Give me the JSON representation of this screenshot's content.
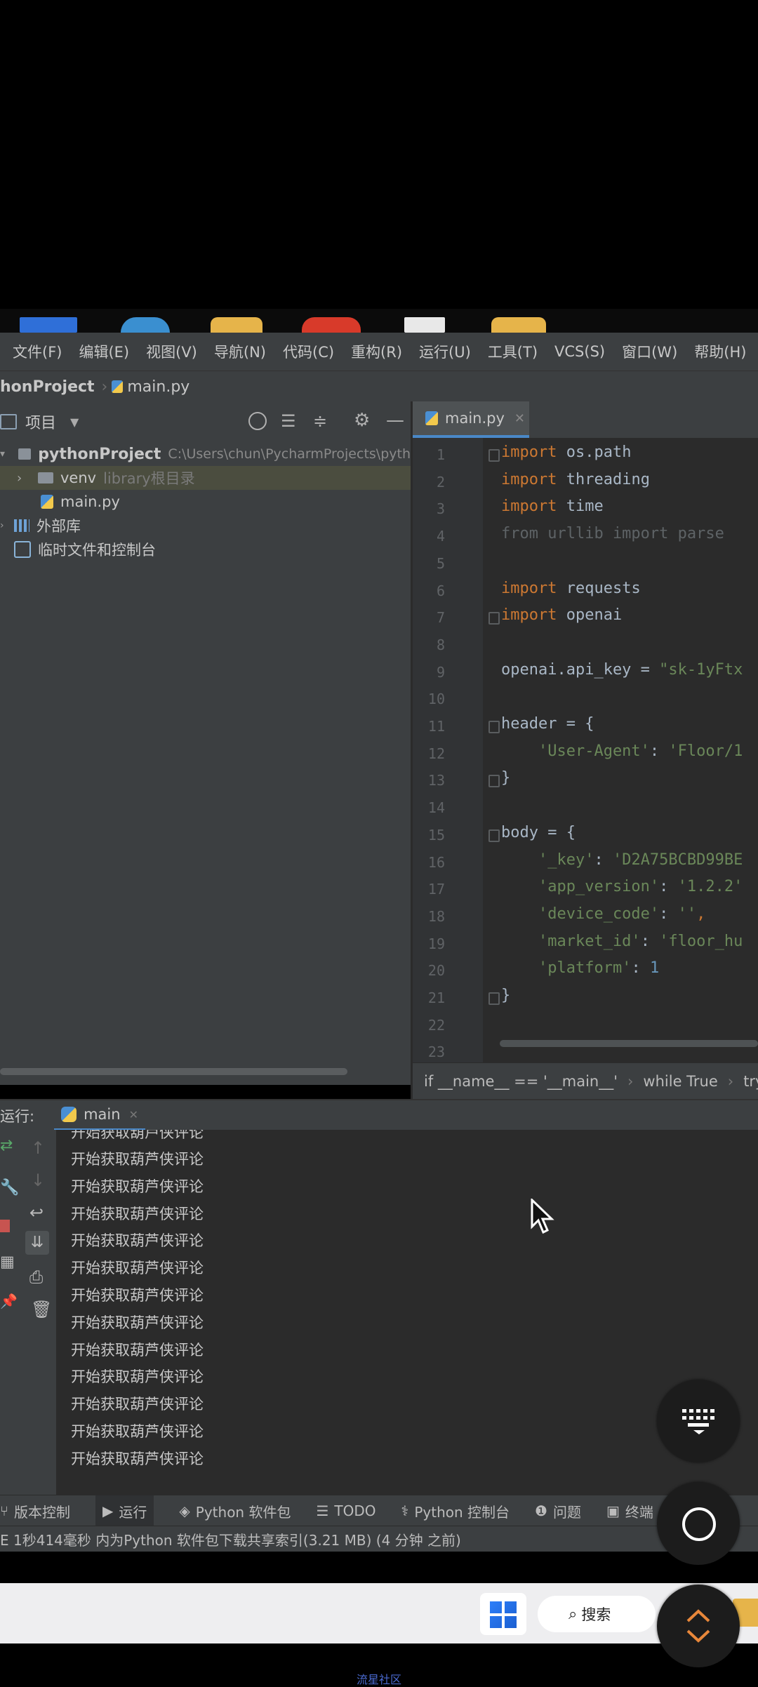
{
  "menu": [
    "文件(F)",
    "编辑(E)",
    "视图(V)",
    "导航(N)",
    "代码(C)",
    "重构(R)",
    "运行(U)",
    "工具(T)",
    "VCS(S)",
    "窗口(W)",
    "帮助(H)"
  ],
  "breadcrumb": {
    "project": "honProject",
    "file": "main.py"
  },
  "project_panel": {
    "title": "项目"
  },
  "tree": {
    "root_name": "pythonProject",
    "root_path": "C:\\Users\\chun\\PycharmProjects\\pyth",
    "venv_name": "venv",
    "venv_note": "library根目录",
    "main_file": "main.py",
    "external_libs": "外部库",
    "scratches": "临时文件和控制台"
  },
  "editor": {
    "tab": "main.py",
    "lines": [
      {
        "n": "1",
        "tokens": [
          {
            "t": "import",
            "c": "kw"
          },
          {
            "t": " os.path",
            "c": ""
          }
        ]
      },
      {
        "n": "2",
        "tokens": [
          {
            "t": "import",
            "c": "kw"
          },
          {
            "t": " threading",
            "c": ""
          }
        ]
      },
      {
        "n": "3",
        "tokens": [
          {
            "t": "import",
            "c": "kw"
          },
          {
            "t": " time",
            "c": ""
          }
        ]
      },
      {
        "n": "4",
        "tokens": [
          {
            "t": "from urllib import parse",
            "c": "dim"
          }
        ]
      },
      {
        "n": "5",
        "tokens": []
      },
      {
        "n": "6",
        "tokens": [
          {
            "t": "import",
            "c": "kw"
          },
          {
            "t": " requests",
            "c": ""
          }
        ]
      },
      {
        "n": "7",
        "tokens": [
          {
            "t": "import",
            "c": "kw"
          },
          {
            "t": " openai",
            "c": ""
          }
        ]
      },
      {
        "n": "8",
        "tokens": []
      },
      {
        "n": "9",
        "tokens": [
          {
            "t": "openai.api_key = ",
            "c": ""
          },
          {
            "t": "\"sk-1yFtx",
            "c": "str"
          }
        ]
      },
      {
        "n": "10",
        "tokens": []
      },
      {
        "n": "11",
        "tokens": [
          {
            "t": "header = {",
            "c": ""
          }
        ]
      },
      {
        "n": "12",
        "tokens": [
          {
            "t": "    'User-Agent'",
            "c": "str"
          },
          {
            "t": ": ",
            "c": ""
          },
          {
            "t": "'Floor/1",
            "c": "str"
          }
        ]
      },
      {
        "n": "13",
        "tokens": [
          {
            "t": "}",
            "c": ""
          }
        ]
      },
      {
        "n": "14",
        "tokens": []
      },
      {
        "n": "15",
        "tokens": [
          {
            "t": "body = {",
            "c": ""
          }
        ]
      },
      {
        "n": "16",
        "tokens": [
          {
            "t": "    '_key'",
            "c": "str"
          },
          {
            "t": ": ",
            "c": ""
          },
          {
            "t": "'D2A75BCBD99BE",
            "c": "str"
          }
        ]
      },
      {
        "n": "17",
        "tokens": [
          {
            "t": "    'app_version'",
            "c": "str"
          },
          {
            "t": ": ",
            "c": ""
          },
          {
            "t": "'1.2.2'",
            "c": "str"
          }
        ]
      },
      {
        "n": "18",
        "tokens": [
          {
            "t": "    'device_code'",
            "c": "str"
          },
          {
            "t": ": ",
            "c": ""
          },
          {
            "t": "''",
            "c": "str"
          },
          {
            "t": ",",
            "c": "kw"
          }
        ]
      },
      {
        "n": "19",
        "tokens": [
          {
            "t": "    'market_id'",
            "c": "str"
          },
          {
            "t": ": ",
            "c": ""
          },
          {
            "t": "'floor_hu",
            "c": "str"
          }
        ]
      },
      {
        "n": "20",
        "tokens": [
          {
            "t": "    'platform'",
            "c": "str"
          },
          {
            "t": ": ",
            "c": ""
          },
          {
            "t": "1",
            "c": "num"
          }
        ]
      },
      {
        "n": "21",
        "tokens": [
          {
            "t": "}",
            "c": ""
          }
        ]
      },
      {
        "n": "22",
        "tokens": []
      },
      {
        "n": "23",
        "tokens": []
      }
    ]
  },
  "code_breadcrumbs": [
    "if __name__ == '__main__'",
    "while True",
    "try"
  ],
  "run": {
    "label": "运行:",
    "tab": "main",
    "partial_line": "开始获取葫芦侠评论",
    "lines": [
      "开始获取葫芦侠评论",
      "开始获取葫芦侠评论",
      "开始获取葫芦侠评论",
      "开始获取葫芦侠评论",
      "开始获取葫芦侠评论",
      "开始获取葫芦侠评论",
      "开始获取葫芦侠评论",
      "开始获取葫芦侠评论",
      "开始获取葫芦侠评论",
      "开始获取葫芦侠评论",
      "开始获取葫芦侠评论",
      "开始获取葫芦侠评论"
    ]
  },
  "tool_windows": [
    "版本控制",
    "运行",
    "Python 软件包",
    "TODO",
    "Python 控制台",
    "问题",
    "终端"
  ],
  "status": "E 1秒414毫秒 内为Python 软件包下载共享索引(3.21 MB) (4 分钟 之前)",
  "taskbar": {
    "search": "搜索"
  },
  "watermark": "流星社区",
  "colors": {
    "ide_bg": "#3c3f41",
    "editor_bg": "#2b2b2b",
    "keyword": "#cc7832",
    "string": "#6a8759",
    "number": "#6897bb"
  }
}
